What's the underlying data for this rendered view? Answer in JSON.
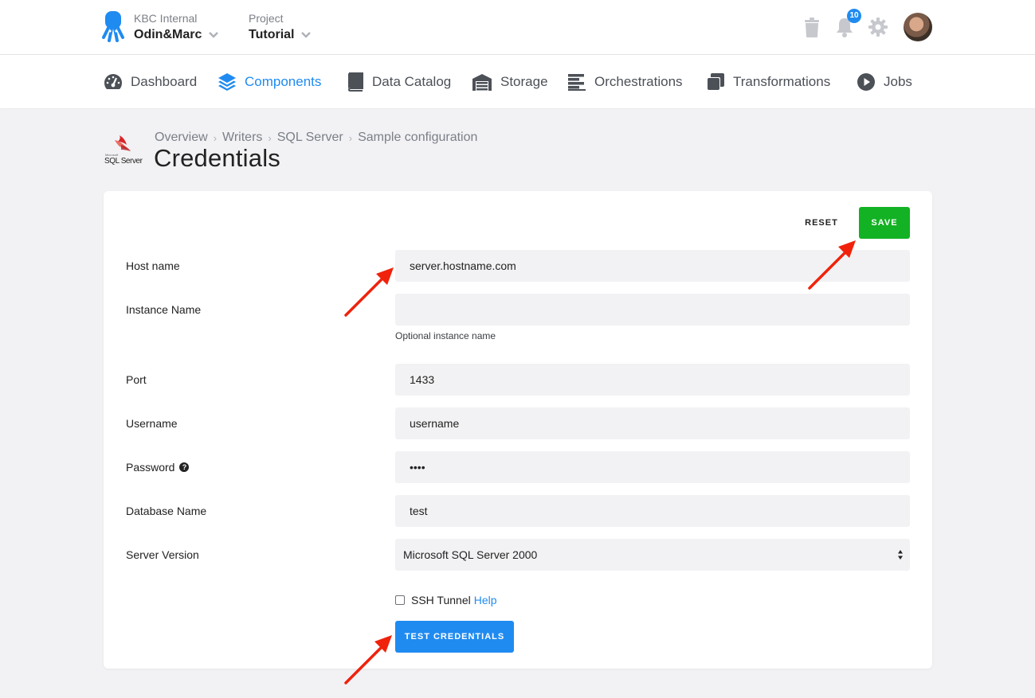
{
  "topbar": {
    "org_label": "KBC Internal",
    "org_name": "Odin&Marc",
    "project_label": "Project",
    "project_name": "Tutorial",
    "notification_count": "10"
  },
  "nav": {
    "items": [
      {
        "label": "Dashboard",
        "icon": "dashboard-icon"
      },
      {
        "label": "Components",
        "icon": "layers-icon",
        "active": true
      },
      {
        "label": "Data Catalog",
        "icon": "book-icon"
      },
      {
        "label": "Storage",
        "icon": "warehouse-icon"
      },
      {
        "label": "Orchestrations",
        "icon": "bars-icon"
      },
      {
        "label": "Transformations",
        "icon": "copy-icon"
      },
      {
        "label": "Jobs",
        "icon": "play-circle-icon"
      }
    ]
  },
  "header": {
    "logo_text": "SQL Server",
    "breadcrumb": [
      "Overview",
      "Writers",
      "SQL Server",
      "Sample configuration"
    ],
    "title": "Credentials"
  },
  "form": {
    "reset_label": "RESET",
    "save_label": "SAVE",
    "fields": {
      "host": {
        "label": "Host name",
        "value": "server.hostname.com"
      },
      "instance": {
        "label": "Instance Name",
        "value": "",
        "help": "Optional instance name"
      },
      "port": {
        "label": "Port",
        "value": "1433"
      },
      "username": {
        "label": "Username",
        "value": "username"
      },
      "password": {
        "label": "Password",
        "value": "••••"
      },
      "database": {
        "label": "Database Name",
        "value": "test"
      },
      "server_version": {
        "label": "Server Version",
        "value": "Microsoft SQL Server 2000"
      }
    },
    "ssh_tunnel_label": "SSH Tunnel",
    "ssh_help_label": "Help",
    "test_label": "TEST CREDENTIALS"
  },
  "colors": {
    "accent": "#1f8bf1",
    "save": "#13b224",
    "annotation_arrow": "#f0220c"
  }
}
